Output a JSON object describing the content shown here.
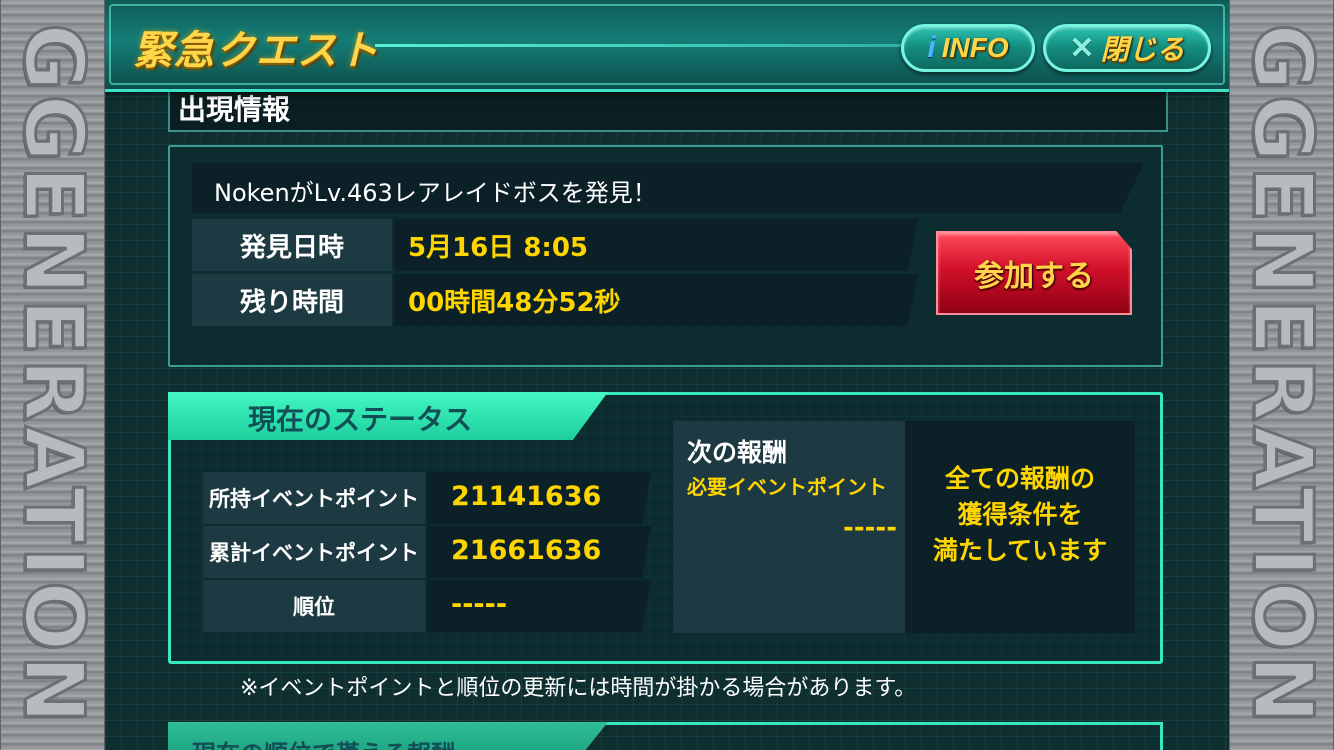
{
  "side_logo": "GGENERATION",
  "header": {
    "title": "緊急クエスト",
    "info_label": "INFO",
    "info_icon": "i",
    "close_label": "閉じる",
    "close_icon": "✕"
  },
  "appearance": {
    "section_title": "出現情報",
    "finder_text": "NokenがLv.463レアレイドボスを発見！",
    "found_label": "発見日時",
    "found_value": "5月16日 8:05",
    "remaining_label": "残り時間",
    "remaining_value": "00時間48分52秒",
    "join_button": "参加する"
  },
  "status": {
    "section_title": "現在のステータス",
    "owned_label": "所持イベントポイント",
    "owned_value": "21141636",
    "total_label": "累計イベントポイント",
    "total_value": "21661636",
    "rank_label": "順位",
    "rank_value": "-----",
    "next_reward_title": "次の報酬",
    "required_points_label": "必要イベントポイント",
    "required_points_value": "-----",
    "all_rewards_line1": "全ての報酬の",
    "all_rewards_line2": "獲得条件を",
    "all_rewards_line3": "満たしています"
  },
  "note": "※イベントポイントと順位の更新には時間が掛かる場合があります。",
  "bottom_section_title": "現在の順位で貰える報酬",
  "colors": {
    "accent": "#37e7bf",
    "value_yellow": "#ffd500",
    "join_red": "#d2102a"
  }
}
